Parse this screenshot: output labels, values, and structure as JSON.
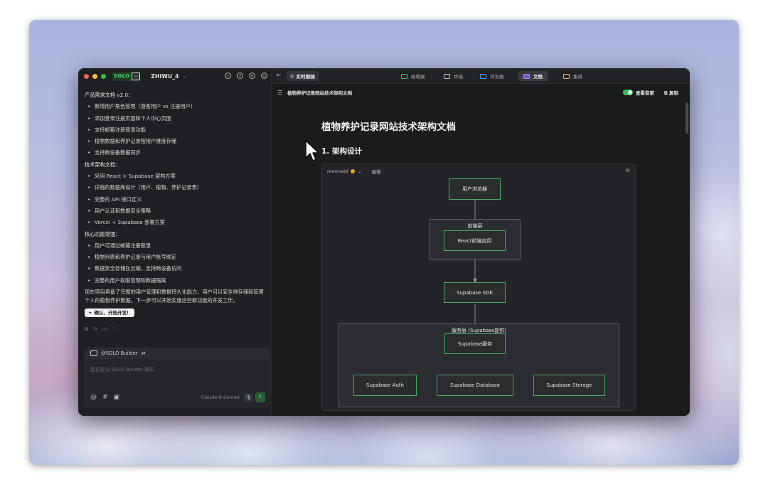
{
  "colors": {
    "accent_green": "#4ad66d",
    "node_border": "#4fa865",
    "traffic_red": "#ff5f57",
    "traffic_yellow": "#febc2e",
    "traffic_green": "#28c840",
    "warn": "#e0a32a"
  },
  "header": {
    "solo_label": "SOLO",
    "project_name": "ZHIWU_4"
  },
  "chat": {
    "section1_title": "产品需求文档 v2.0：",
    "section1_items": [
      "新增用户角色管理（游客用户 vs 注册用户）",
      "添加登录注册页面和个人中心页面",
      "支持邮箱注册登录功能",
      "植物数据和养护记录按用户维度存储",
      "支持跨设备数据同步"
    ],
    "section2_title": "技术架构文档：",
    "section2_items": [
      "采用 React + Supabase 架构方案",
      "详细的数据库设计（用户、植物、养护记录表）",
      "完整的 API 接口定义",
      "用户认证和数据安全策略",
      "Vercel + Supabase 部署方案"
    ],
    "section3_title": "核心功能增强：",
    "section3_items": [
      "用户可通过邮箱注册登录",
      "植物列表和养护记录与用户账号绑定",
      "数据安全存储在云端，支持跨设备访问",
      "完整的用户权限管理和数据隔离"
    ],
    "summary": "现在项目具备了完整的用户管理和数据持久化能力，用户可以安全地存储和管理个人的植物养护数据。下一步可以开始实施这些新功能的开发工作。",
    "confirm_button": "确认，开始开发！"
  },
  "composer": {
    "agent_label": "@SOLO Builder",
    "placeholder": "您正在与 SOLO Builder 聊天",
    "model": "Claude-4-Sonnet"
  },
  "tabs": {
    "live_follow": "实时跟随",
    "items": [
      {
        "label": "编辑器",
        "icon": "editor-icon",
        "color": "#4fbf6a"
      },
      {
        "label": "终端",
        "icon": "terminal-icon",
        "color": "#bdbdbd"
      },
      {
        "label": "浏览器",
        "icon": "browser-icon",
        "color": "#4c9ee8"
      },
      {
        "label": "文档",
        "icon": "document-icon",
        "color": "#a98bf0",
        "active": true
      },
      {
        "label": "集成",
        "icon": "integration-icon",
        "color": "#e6c14a"
      }
    ]
  },
  "doc": {
    "file_name": "植物养护记录网站技术架构文档",
    "view_changes": "查看变更",
    "copy": "复制",
    "title": "植物养护记录网站技术架构文档",
    "section_heading": "1. 架构设计",
    "mermaid_label": "mermaid",
    "edit_label": "编辑"
  },
  "diagram": {
    "nodes": {
      "browser": "用户浏览器",
      "frontend": "React前端应用",
      "sdk": "Supabase SDK",
      "service": "Supabase服务",
      "auth": "Supabase Auth",
      "database": "Supabase Database",
      "storage": "Supabase Storage"
    },
    "groups": {
      "frontend_layer": "前端层",
      "service_layer": "服务层 (Supabase提供)"
    }
  }
}
